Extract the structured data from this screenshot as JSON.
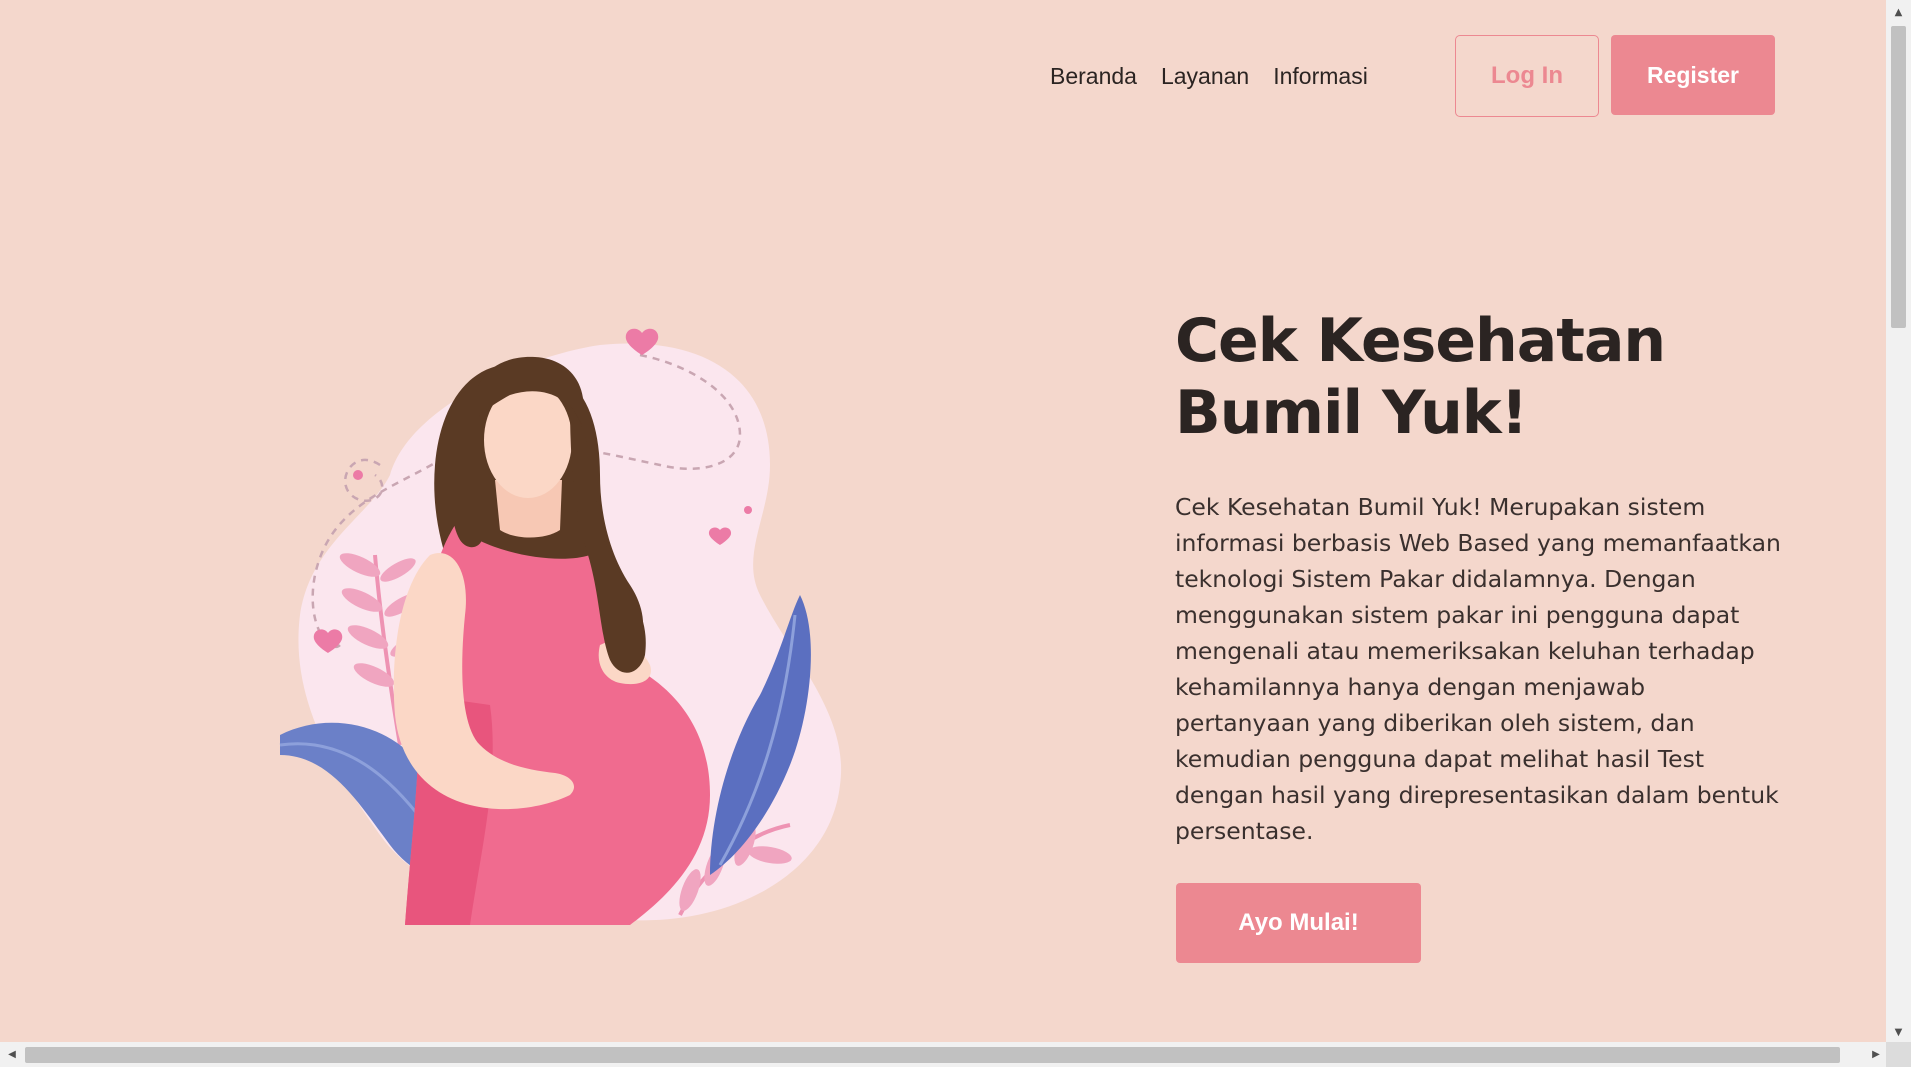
{
  "nav": {
    "links": [
      "Beranda",
      "Layanan",
      "Informasi"
    ],
    "login_label": "Log In",
    "register_label": "Register"
  },
  "hero": {
    "title_line1": "Cek Kesehatan",
    "title_line2": "Bumil Yuk!",
    "description": "Cek Kesehatan Bumil Yuk! Merupakan sistem informasi berbasis Web Based yang memanfaatkan teknologi Sistem Pakar didalamnya. Dengan menggunakan sistem pakar ini pengguna dapat mengenali atau memeriksakan keluhan terhadap kehamilannya hanya dengan menjawab pertanyaan yang diberikan oleh sistem, dan kemudian pengguna dapat melihat hasil Test dengan hasil yang direpresentasikan dalam bentuk persentase.",
    "cta_label": "Ayo Mulai!"
  },
  "scrollbars": {
    "up_icon": "▲",
    "down_icon": "▼",
    "left_icon": "◀",
    "right_icon": "▶"
  },
  "colors": {
    "background": "#f4d7cc",
    "accent": "#ec8891",
    "text": "#2b2422"
  }
}
